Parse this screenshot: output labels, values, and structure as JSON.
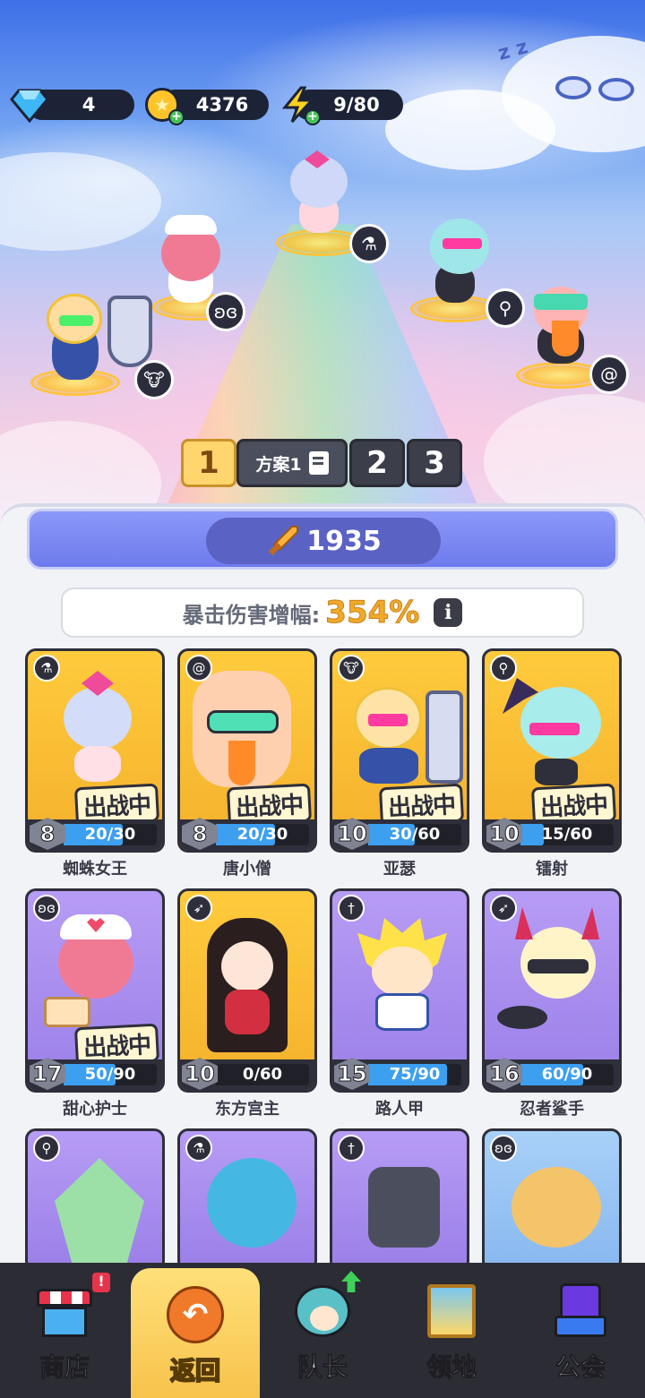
{
  "resources": {
    "gems": "4",
    "coins": "4376",
    "energy": "9/80"
  },
  "presets": {
    "tab1": "1",
    "active_name": "方案1",
    "tab2": "2",
    "tab3": "3"
  },
  "power": {
    "value": "1935"
  },
  "crit": {
    "label": "暴击伤害增幅:",
    "value": "354%",
    "info": "i"
  },
  "in_battle_label": "出战中",
  "heroes": [
    {
      "name": "蜘蛛女王",
      "level": "8",
      "progress": "20/30",
      "ratio": 0.667,
      "in_battle": true,
      "bg": "gold",
      "class": "potion-icon"
    },
    {
      "name": "唐小僧",
      "level": "8",
      "progress": "20/30",
      "ratio": 0.667,
      "in_battle": true,
      "bg": "gold",
      "class": "spiral-icon"
    },
    {
      "name": "亚瑟",
      "level": "10",
      "progress": "30/60",
      "ratio": 0.5,
      "in_battle": true,
      "bg": "gold",
      "class": "ox-icon"
    },
    {
      "name": "镭射",
      "level": "10",
      "progress": "15/60",
      "ratio": 0.25,
      "in_battle": true,
      "bg": "gold",
      "class": "staff-icon"
    },
    {
      "name": "甜心护士",
      "level": "17",
      "progress": "50/90",
      "ratio": 0.556,
      "in_battle": true,
      "bg": "purple",
      "class": "wings-icon"
    },
    {
      "name": "东方宫主",
      "level": "10",
      "progress": "0/60",
      "ratio": 0,
      "in_battle": false,
      "bg": "gold",
      "class": "bow-icon"
    },
    {
      "name": "路人甲",
      "level": "15",
      "progress": "75/90",
      "ratio": 0.833,
      "in_battle": false,
      "bg": "purple",
      "class": "sword-icon"
    },
    {
      "name": "忍者鲨手",
      "level": "16",
      "progress": "60/90",
      "ratio": 0.667,
      "in_battle": false,
      "bg": "purple",
      "class": "bow-icon"
    }
  ],
  "nav": {
    "shop": "商店",
    "back": "返回",
    "captain": "队长",
    "territory": "领地",
    "guild": "公会",
    "shop_alert": "!"
  }
}
